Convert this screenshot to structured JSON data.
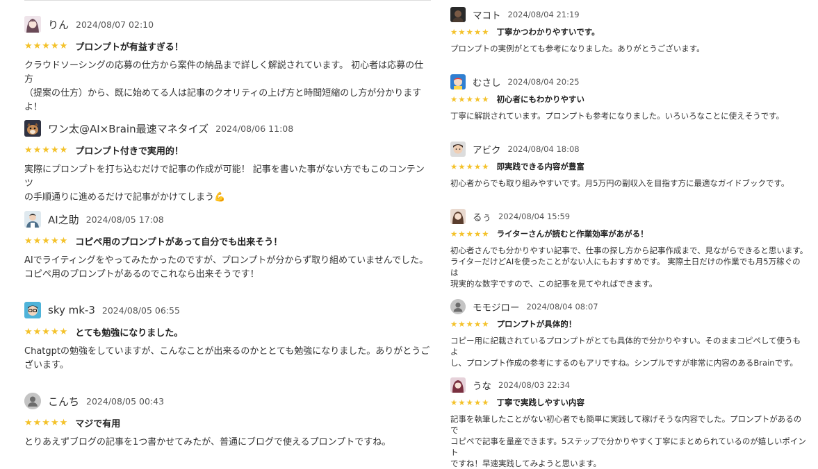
{
  "colors": {
    "star": "#f4c22b",
    "text": "#333333",
    "divider": "#dcdcdc"
  },
  "left_reviews": [
    {
      "avatar": "anime-girl-avatar",
      "user": "りん",
      "date": "2024/08/07 02:10",
      "stars": "★★★★★",
      "title": "プロンプトが有益すぎる！",
      "body": [
        "クラウドソーシングの応募の仕方から案件の納品まで詳しく解説されています。 初心者は応募の仕方",
        "（提案の仕方）から、既に始めてる人は記事のクオリティの上げ方と時間短縮のし方が分かります",
        "よ！"
      ]
    },
    {
      "avatar": "dog-avatar",
      "user": "ワン太@AI×Brain最速マネタイズ",
      "date": "2024/08/06 11:08",
      "stars": "★★★★★",
      "title": "プロンプト付きで実用的！",
      "body": [
        "実際にプロンプトを打ち込むだけで記事の作成が可能！ 記事を書いた事がない方でもこのコンテンツ",
        "の手順通りに進めるだけで記事がかけてしまう💪"
      ]
    },
    {
      "avatar": "person-avatar",
      "user": "AI之助",
      "date": "2024/08/05 17:08",
      "stars": "★★★★★",
      "title": "コピペ用のプロンプトがあって自分でも出来そう！",
      "body": [
        "AIでライティングをやってみたかったのですが、プロンプトが分からず取り組めていませんでした。",
        "コピペ用のプロンプトがあるのでこれなら出来そうです！"
      ]
    },
    {
      "avatar": "glasses-avatar",
      "user": "sky mk-3",
      "date": "2024/08/05 06:55",
      "stars": "★★★★★",
      "title": "とても勉強になりました。",
      "body": [
        "Chatgptの勉強をしていますが、こんなことが出来るのかととても勉強になりました。ありがとうご",
        "ざいます。"
      ]
    },
    {
      "avatar": "default-user-avatar",
      "user": "こんち",
      "date": "2024/08/05 00:43",
      "stars": "★★★★★",
      "title": "マジで有用",
      "body": [
        "とりあえずブログの記事を1つ書かせてみたが、普通にブログで使えるプロンプトですね。"
      ]
    }
  ],
  "right_reviews": [
    {
      "avatar": "dark-avatar",
      "user": "マコト",
      "date": "2024/08/04 21:19",
      "stars": "★★★★★",
      "title": "丁寧かつわかりやすいです。",
      "body": [
        "プロンプトの実例がとても参考になりました。ありがとうございます。"
      ]
    },
    {
      "avatar": "blue-character-avatar",
      "user": "むさし",
      "date": "2024/08/04 20:25",
      "stars": "★★★★★",
      "title": "初心者にもわかりやすい",
      "body": [
        "丁寧に解説されています。プロンプトも参考になりました。いろいろなことに使えそうです。"
      ]
    },
    {
      "avatar": "face-avatar",
      "user": "アビク",
      "date": "2024/08/04 18:08",
      "stars": "★★★★★",
      "title": "即実践できる内容が豊富",
      "body": [
        "初心者からでも取り組みやすいです。月5万円の副収入を目指す方に最適なガイドブックです。"
      ]
    },
    {
      "avatar": "girl-avatar",
      "user": "るぅ",
      "date": "2024/08/04 15:59",
      "stars": "★★★★★",
      "title": "ライターさんが読むと作業効率があがる！",
      "body": [
        "初心者さんでも分かりやすい記事で、仕事の探し方から記事作成まで、見ながらできると思います。",
        "ライターだけどAIを使ったことがない人にもおすすめです。 実際土日だけの作業でも月5万稼ぐのは",
        "現実的な数字ですので、この記事を見てやればできます。"
      ]
    },
    {
      "avatar": "default-user-avatar",
      "user": "モモジロー",
      "date": "2024/08/04 08:07",
      "stars": "★★★★★",
      "title": "プロンプトが具体的！",
      "body": [
        "コピー用に記載されているプロンプトがとても具体的で分かりやすい。そのままコピペして使うもよ",
        "し、プロンプト作成の参考にするのもアリですね。シンプルですが非常に内容のあるBrainです。"
      ]
    },
    {
      "avatar": "anime-avatar",
      "user": "うな",
      "date": "2024/08/03 22:34",
      "stars": "★★★★★",
      "title": "丁寧で実践しやすい内容",
      "body": [
        "記事を執筆したことがない初心者でも簡単に実践して稼げそうな内容でした。プロンプトがあるので",
        "コピペで記事を量産できます。5ステップで分かりやすく丁寧にまとめられているのが嬉しいポイント",
        "ですね！早速実践してみようと思います。"
      ]
    }
  ]
}
